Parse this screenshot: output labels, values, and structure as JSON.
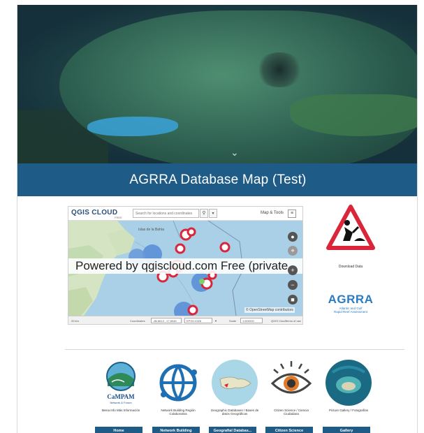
{
  "page": {
    "title": "AGRRA Database Map (Test)"
  },
  "map": {
    "logo": "QGIS CLOUD",
    "logo_sub": "FREE",
    "search_placeholder": "Search for locations and coordinates",
    "map_tools": "Map & Tools",
    "powered_banner": "Powered by qgiscloud.com Free (private",
    "attribution": "© OpenStreetMap contributors",
    "status": {
      "scale": "20 km",
      "coordinates_label": "Coordinates",
      "coordinates_value": "-86.8613 , 17.8046",
      "crs": "EPSG:4326",
      "scale_label": "Scale",
      "scale_value": "1:500000",
      "cloud_label": "QGIS Cloud",
      "terms": "Terms of use"
    }
  },
  "sidebar": {
    "download_label": "Download Data",
    "agrra_name": "AGRRA",
    "agrra_sub_1": "Atlantic and Gulf",
    "agrra_sub_2": "Rapid Reef Assessment"
  },
  "tiles": [
    {
      "caption": "Mena Info Más Información",
      "button": "Home",
      "icon": "campam-logo-icon",
      "logo_text": "CaMPAM",
      "logo_sub": "Network & Forum"
    },
    {
      "caption": "Network Building Región Colaborativa",
      "button": "Network Building",
      "icon": "network-globe-icon"
    },
    {
      "caption": "Geographic Databases / Bases de datos Geográficas",
      "button": "Geografial Databas...",
      "icon": "island-map-icon"
    },
    {
      "caption": "Citizen Science / Ciencia Ciudadana",
      "button": "Citizen Science",
      "icon": "eye-icon"
    },
    {
      "caption": "Picture Gallery / Fotografías",
      "button": "Gallery",
      "icon": "aerial-reef-icon"
    }
  ],
  "colors": {
    "brand_blue": "#1f5b87",
    "agrra_blue": "#2a7bc2",
    "marker_red": "#d9263b"
  }
}
